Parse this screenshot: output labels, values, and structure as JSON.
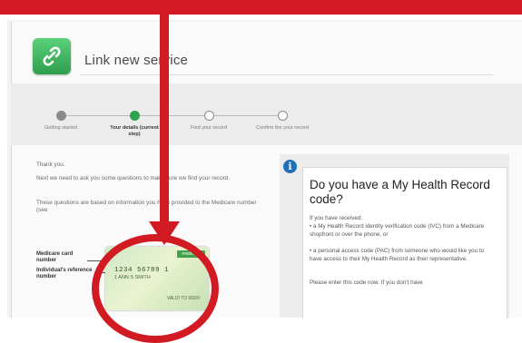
{
  "header": {
    "title": "Link new service"
  },
  "steps": [
    {
      "label": "Getting started",
      "state": "done"
    },
    {
      "label": "Your details (current step)",
      "state": "current"
    },
    {
      "label": "Find your record",
      "state": "todo"
    },
    {
      "label": "Confirm the your record",
      "state": "todo"
    }
  ],
  "left": {
    "thanks": "Thank you.",
    "intro": "Next we need to ask you some questions to make sure we find your record.",
    "based_on": "These questions are based on information you have provided to the Medicare number (see",
    "medicare_label": "Medicare card number",
    "irn_label": "Individual's reference number",
    "card": {
      "tag": "medicare",
      "number": "1234 56789 1",
      "name": "1 ANN S SMITH",
      "valid": "VALID TO 00/00"
    }
  },
  "right": {
    "title": "Do you have a My Health Record code?",
    "received": "If you have received:",
    "bullet1": "• a My Health Record identity verification code (IVC) from a Medicare shopfront or over the phone, or",
    "bullet2": "• a personal access code (PAC) from someone who would like you to have access to their My Health Record as their representative.",
    "enter_code": "Please enter this code now. If you don't have"
  },
  "colors": {
    "annotation_red": "#d21a22",
    "brand_green": "#2fa44f",
    "info_blue": "#1f6fb8"
  }
}
